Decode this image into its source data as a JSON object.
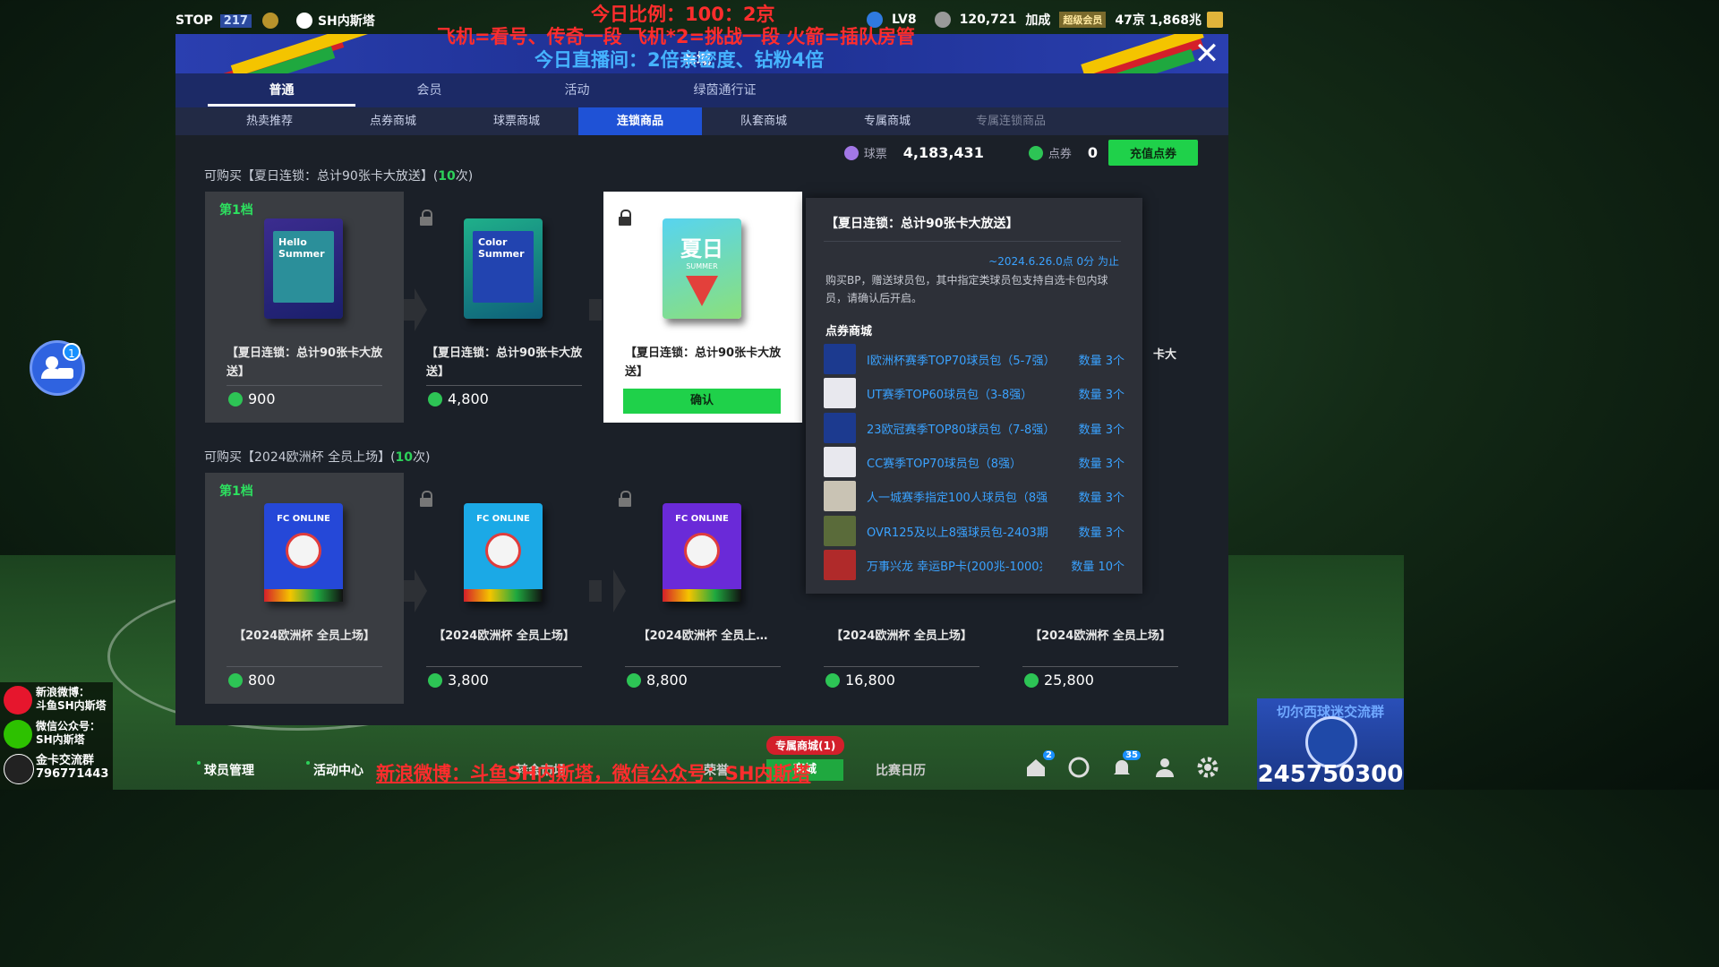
{
  "overlay": {
    "line1": "今日比例：100：2京",
    "line2": "飞机=看号、传奇一段   飞机*2=挑战一段   火箭=插队房管",
    "line3": "今日直播间：2倍亲密度、钻粉4倍"
  },
  "topbar": {
    "stop": "STOP",
    "level": "217",
    "channel": "SH内斯塔",
    "rank": "LV8",
    "points": "120,721",
    "boost": "加成",
    "vip": "超级会员",
    "balance": "47京 1,868兆"
  },
  "shop": {
    "title": "商城",
    "tabs": [
      "普通",
      "会员",
      "活动",
      "绿茵通行证"
    ],
    "subtabs": [
      "热卖推荐",
      "点券商城",
      "球票商城",
      "连锁商品",
      "队套商城",
      "专属商城",
      "专属连锁商品"
    ],
    "ticket_label": "球票",
    "ticket_value": "4,183,431",
    "coupon_label": "点券",
    "coupon_value": "0",
    "recharge": "充值点券"
  },
  "sections": [
    {
      "title_prefix": "可购买【夏日连锁：总计90张卡大放送】(",
      "count": "10",
      "title_suffix": "次)",
      "tier": "第1档",
      "cards": [
        {
          "name": "【夏日连锁：总计90张卡大放送】",
          "price": "900",
          "pack_text": "Hello Summer"
        },
        {
          "name": "【夏日连锁：总计90张卡大放送】",
          "price": "4,800",
          "pack_text": "Color Summer"
        },
        {
          "name": "【夏日连锁：总计90张卡大放送】",
          "confirm": "确认",
          "pack_text": "夏日",
          "pack_sub": "SUMMER"
        },
        {
          "name_partial": "卡大"
        }
      ]
    },
    {
      "title_prefix": "可购买【2024欧洲杯 全员上场】(",
      "count": "10",
      "title_suffix": "次)",
      "tier": "第1档",
      "cards": [
        {
          "name": "【2024欧洲杯 全员上场】",
          "price": "800",
          "pack_text": "FC ONLINE"
        },
        {
          "name": "【2024欧洲杯 全员上场】",
          "price": "3,800",
          "pack_text": "FC ONLINE"
        },
        {
          "name": "【2024欧洲杯 全员上…",
          "price": "8,800",
          "pack_text": "FC ONLINE"
        },
        {
          "name": "【2024欧洲杯 全员上场】",
          "price": "16,800"
        },
        {
          "name": "【2024欧洲杯 全员上场】",
          "price": "25,800"
        }
      ]
    }
  ],
  "tooltip": {
    "title": "【夏日连锁：总计90张卡大放送】",
    "deadline": "~2024.6.26.0点 0分 为止",
    "desc": "购买BP，赠送球员包，其中指定类球员包支持自选卡包内球员，请确认后开启。",
    "shop_label": "点券商城",
    "items": [
      {
        "name": "I欧洲杯赛季TOP70球员包（5-7强）",
        "qty": "数量 3个",
        "thumb": "#1c3a8f"
      },
      {
        "name": "UT赛季TOP60球员包（3-8强）",
        "qty": "数量 3个",
        "thumb": "#e8e8ee"
      },
      {
        "name": "23欧冠赛季TOP80球员包（7-8强）",
        "qty": "数量 3个",
        "thumb": "#1c3a8f"
      },
      {
        "name": "CC赛季TOP70球员包（8强）",
        "qty": "数量 3个",
        "thumb": "#e8e8ee"
      },
      {
        "name": "人一城赛季指定100人球员包（8强",
        "qty": "数量 3个",
        "thumb": "#c9c3b4"
      },
      {
        "name": "OVR125及以上8强球员包-2403期",
        "qty": "数量 3个",
        "thumb": "#5a6b3a"
      },
      {
        "name": "万事兴龙 幸运BP卡(200兆-1000兆)",
        "qty": "数量 10个",
        "thumb": "#b02a2a"
      }
    ]
  },
  "chat": {
    "badge": "1"
  },
  "bottom_nav": {
    "items": [
      "球员管理",
      "活动中心",
      "转会市场",
      "荣誉",
      "商城",
      "比赛日历"
    ],
    "exclusive": "专属商城(1)",
    "badges": {
      "home": "2",
      "bell": "35"
    }
  },
  "ticker": "新浪微博：斗鱼SH内斯塔，微信公众号：SH内斯塔",
  "info_panel": {
    "weibo": "新浪微博：",
    "weibo_name": "斗鱼SH内斯塔",
    "wechat": "微信公众号：",
    "wechat_name": "SH内斯塔",
    "group": "金卡交流群",
    "group_num": "796771443"
  },
  "fan_group": {
    "title": "切尔西球迷交流群",
    "number": "245750300"
  },
  "colors": {
    "accent": "#1fd14a",
    "link": "#3aa2ff",
    "warning": "#ff2d2d"
  }
}
